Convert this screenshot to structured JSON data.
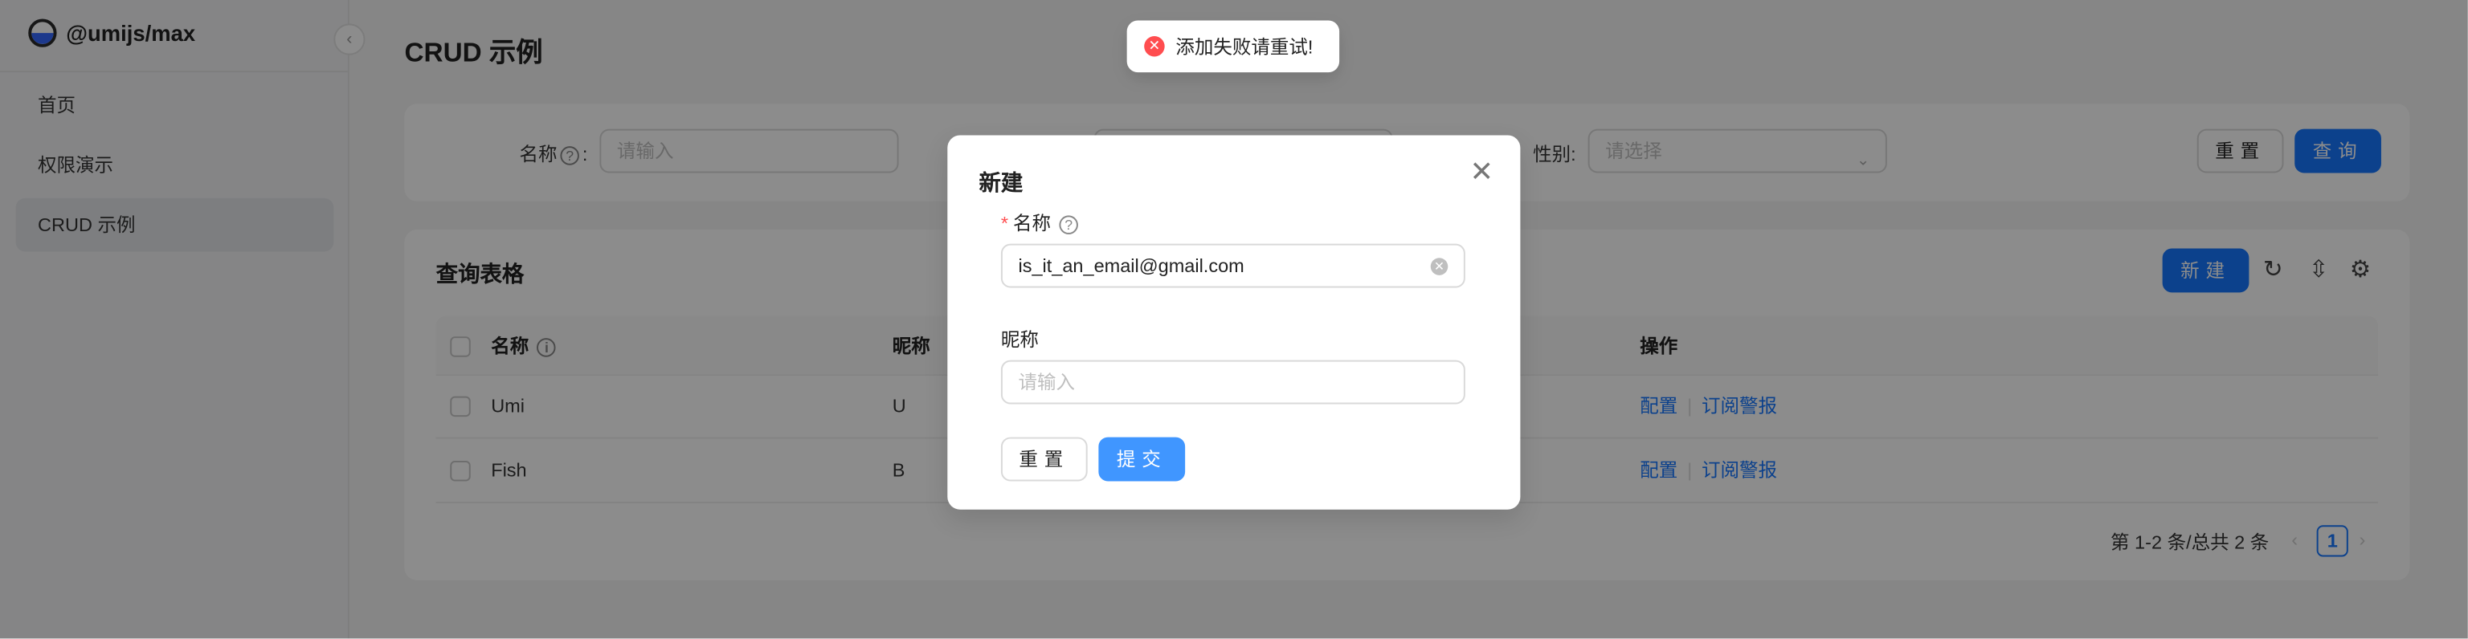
{
  "app": {
    "name": "@umijs/max"
  },
  "sidebar": {
    "items": [
      {
        "label": "首页"
      },
      {
        "label": "权限演示"
      },
      {
        "label": "CRUD 示例"
      }
    ]
  },
  "page": {
    "title": "CRUD 示例"
  },
  "search": {
    "name_label": "名称",
    "name_placeholder": "请输入",
    "gender_label": "性别",
    "gender_placeholder": "请选择",
    "reset_label": "重置",
    "query_label": "查询"
  },
  "table": {
    "title": "查询表格",
    "new_label": "新建",
    "columns": [
      "名称",
      "昵称",
      "操作"
    ],
    "rows": [
      {
        "name": "Umi",
        "nickname": "U",
        "action1": "配置",
        "action2": "订阅警报"
      },
      {
        "name": "Fish",
        "nickname": "B",
        "action1": "配置",
        "action2": "订阅警报"
      }
    ],
    "pagination": {
      "summary": "第 1-2 条/总共 2 条",
      "current_page": "1"
    }
  },
  "message": {
    "text": "添加失败请重试!"
  },
  "modal": {
    "title": "新建",
    "name_label": "名称",
    "name_value": "is_it_an_email@gmail.com",
    "nickname_label": "昵称",
    "nickname_placeholder": "请输入",
    "reset_label": "重置",
    "submit_label": "提交"
  },
  "colors": {
    "primary": "#1677ff",
    "error": "#ff4d4f"
  }
}
